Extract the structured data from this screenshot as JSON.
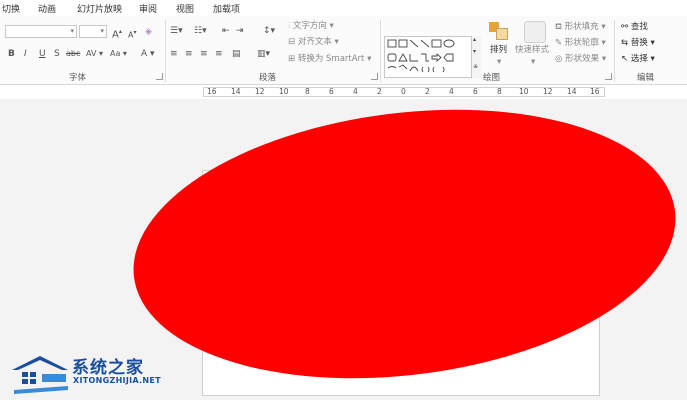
{
  "menu": {
    "items": [
      "切换",
      "动画",
      "幻灯片放映",
      "审阅",
      "视图",
      "加载项"
    ]
  },
  "ribbon": {
    "font_group": {
      "label": "字体",
      "font_name": "",
      "font_size": "",
      "grow_label": "A",
      "shrink_label": "A",
      "bold": "B",
      "italic": "I",
      "underline": "U",
      "shadow": "S",
      "strike": "abc",
      "spacing": "AV",
      "case": "Aa",
      "color": "A"
    },
    "paragraph_group": {
      "label": "段落",
      "text_direction": "文字方向",
      "align_text": "对齐文本",
      "smartart": "转换为 SmartArt"
    },
    "drawing_group": {
      "label": "绘图",
      "arrange": "排列",
      "quick_styles": "快速样式",
      "shape_fill": "形状填充",
      "shape_outline": "形状轮廓",
      "shape_effects": "形状效果"
    },
    "editing_group": {
      "label": "编辑",
      "find": "查找",
      "replace": "替换",
      "select": "选择"
    }
  },
  "ruler": {
    "labels": [
      "16",
      "14",
      "12",
      "10",
      "8",
      "6",
      "4",
      "2",
      "0",
      "2",
      "4",
      "6",
      "8",
      "10",
      "12",
      "14",
      "16"
    ]
  },
  "slide": {
    "shape_color": "#ff0000"
  },
  "watermark": {
    "title": "系统之家",
    "url": "XITONGZHIJIA.NET",
    "color": "#1a4f9c"
  }
}
